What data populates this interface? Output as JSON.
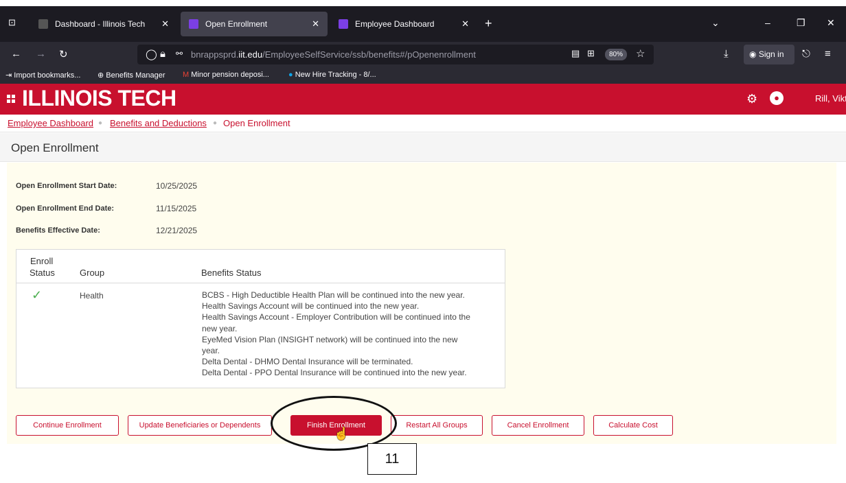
{
  "browser": {
    "tabs": [
      {
        "title": "Dashboard - Illinois Tech",
        "active": false
      },
      {
        "title": "Open Enrollment",
        "active": true
      },
      {
        "title": "Employee Dashboard",
        "active": false
      }
    ],
    "url_prefix": "bnrappsprd.",
    "url_domain": "iit.edu",
    "url_path": "/EmployeeSelfService/ssb/benefits#/pOpenenrollment",
    "zoom": "80%",
    "sign_in": "Sign in",
    "bookmarks": [
      "Import bookmarks...",
      "Benefits Manager",
      "Minor pension deposi...",
      "New Hire Tracking - 8/..."
    ]
  },
  "app": {
    "brand": "ILLINOIS TECH",
    "user_name": "Rill, Viktoria",
    "accent_color": "#c8102e"
  },
  "breadcrumb": {
    "items": [
      "Employee Dashboard",
      "Benefits and Deductions",
      "Open Enrollment"
    ]
  },
  "page": {
    "title": "Open Enrollment",
    "start_label": "Open Enrollment Start Date:",
    "start_value": "10/25/2025",
    "end_label": "Open Enrollment End Date:",
    "end_value": "11/15/2025",
    "effective_label": "Benefits Effective Date:",
    "effective_value": "12/21/2025"
  },
  "table": {
    "headers": {
      "enroll_line1": "Enroll",
      "enroll_line2": "Status",
      "group": "Group",
      "benefits": "Benefits Status"
    },
    "rows": [
      {
        "status_icon": "checkmark-icon",
        "group": "Health",
        "benefits_lines": [
          "BCBS - High Deductible Health Plan will be continued into the new year.",
          "Health Savings Account will be continued into the new year.",
          "Health Savings Account - Employer Contribution will be continued into the",
          "new year.",
          "EyeMed Vision Plan (INSIGHT network) will be continued into the new",
          "year.",
          "Delta Dental - DHMO Dental Insurance will be terminated.",
          "Delta Dental - PPO Dental Insurance will be continued into the new year."
        ]
      }
    ]
  },
  "buttons": {
    "continue": "Continue Enrollment",
    "update": "Update Beneficiaries or Dependents",
    "finish": "Finish Enrollment",
    "restart": "Restart All Groups",
    "cancel": "Cancel Enrollment",
    "calculate": "Calculate Cost"
  },
  "annotation": {
    "step_number": "11"
  }
}
